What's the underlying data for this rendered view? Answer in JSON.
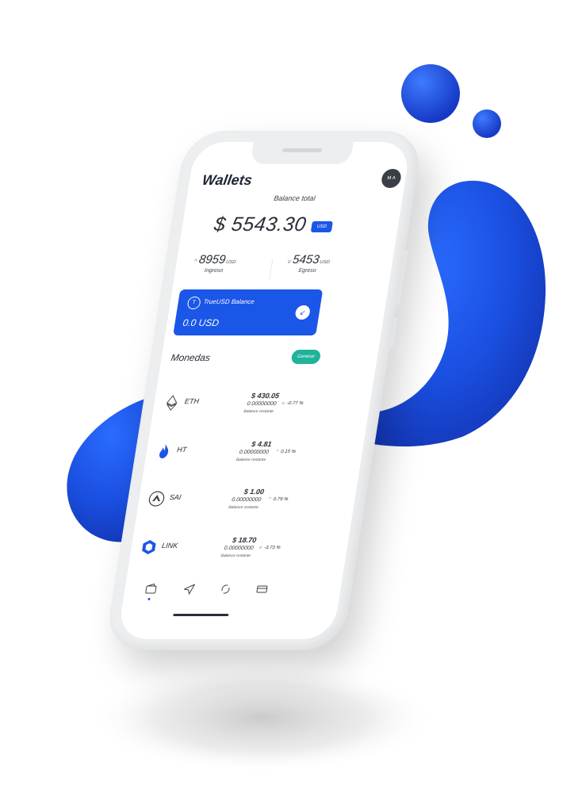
{
  "colors": {
    "accent": "#1a56e8",
    "generate_button": "#1fb39a",
    "avatar": "#3a3f47",
    "text": "#2a2f38"
  },
  "header": {
    "title": "Wallets",
    "avatar_initials": "M A"
  },
  "balance": {
    "label": "Balance total",
    "amount": "$ 5543.30",
    "currency": "USD"
  },
  "stats": {
    "income": {
      "arrow": "^",
      "value": "8959",
      "unit": "USD",
      "label": "Ingreso"
    },
    "expense": {
      "arrow": "v",
      "value": "5453",
      "unit": "USD",
      "label": "Egreso"
    }
  },
  "card": {
    "logo": "T",
    "name": "TrueUSD Balance",
    "value": "0.0 USD",
    "action_icon": "arrow-icon"
  },
  "coins_section": {
    "title": "Monedas",
    "generate_label": "Generar"
  },
  "coins": [
    {
      "symbol": "ETH",
      "price": "$ 430.05",
      "amount": "0.00000000",
      "sub": "Balance restante",
      "change_arrow": "v",
      "change": "-0.77 %"
    },
    {
      "symbol": "HT",
      "price": "$ 4.81",
      "amount": "0.00000000",
      "sub": "Balance restante",
      "change_arrow": "^",
      "change": "0.15 %"
    },
    {
      "symbol": "SAI",
      "price": "$ 1.00",
      "amount": "0.00000000",
      "sub": "Balance restante",
      "change_arrow": "^",
      "change": "0.79 %"
    },
    {
      "symbol": "LINK",
      "price": "$ 18.70",
      "amount": "0.00000000",
      "sub": "Balance restante",
      "change_arrow": "v",
      "change": "-3.73 %"
    }
  ],
  "tabbar": {
    "icons": [
      "wallet-icon",
      "send-icon",
      "exchange-icon",
      "card-icon"
    ],
    "active": 0
  }
}
